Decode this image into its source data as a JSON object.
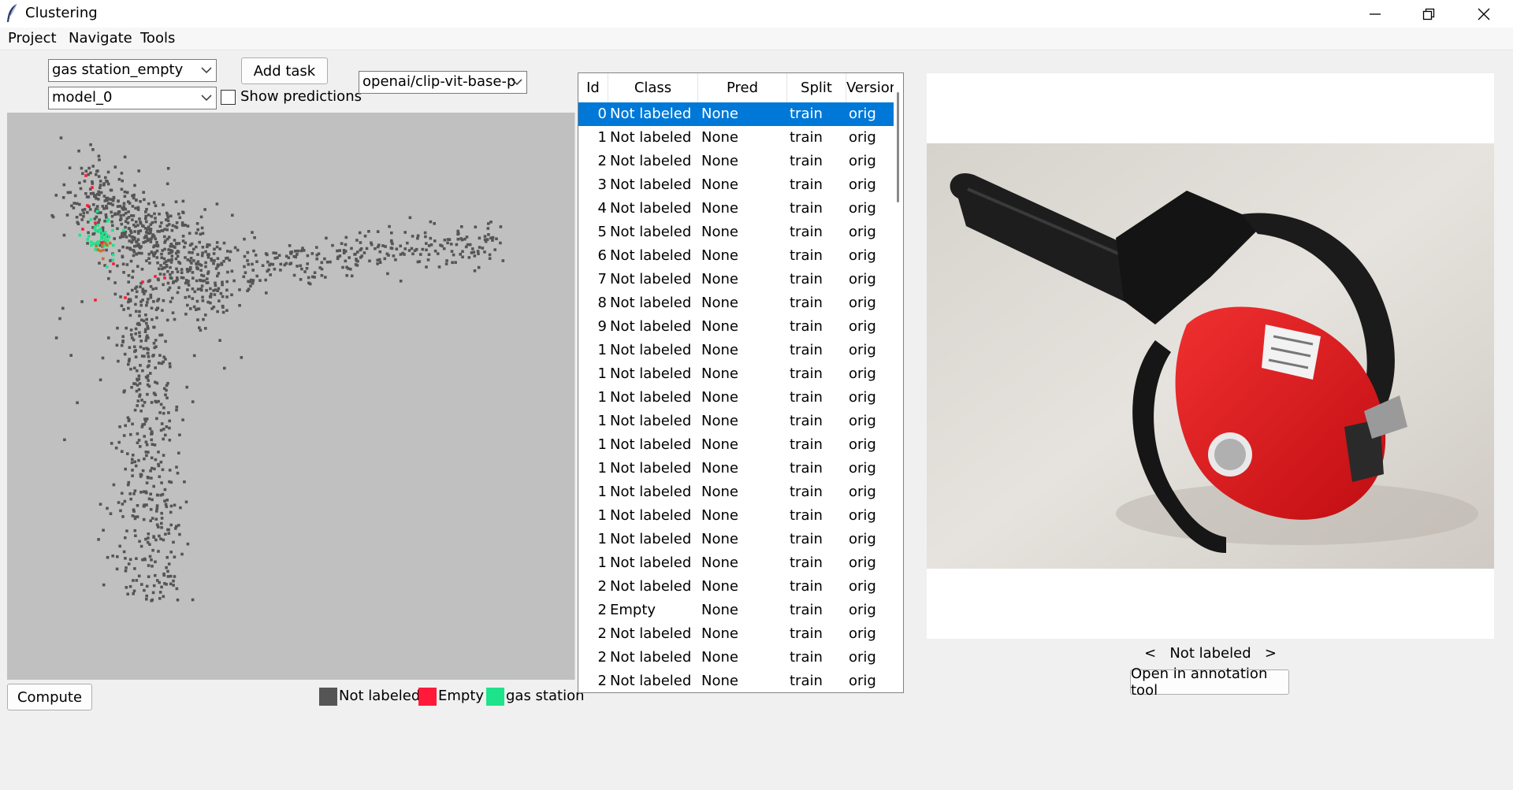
{
  "window": {
    "title": "Clustering"
  },
  "menu": [
    "Project",
    "Navigate",
    "Tools"
  ],
  "controls": {
    "task_select": "gas station_empty",
    "model_select": "model_0",
    "add_task_label": "Add task",
    "show_predictions_label": "Show predictions",
    "show_predictions_checked": false,
    "embedding_model_select": "openai/clip-vit-base-p",
    "compute_label": "Compute"
  },
  "legend": [
    {
      "label": "Not labeled",
      "color": "#555555"
    },
    {
      "label": "Empty",
      "color": "#ff1a3a"
    },
    {
      "label": "gas station",
      "color": "#1fe38a"
    }
  ],
  "table": {
    "columns": [
      "Id",
      "Class",
      "Pred",
      "Split",
      "Version"
    ],
    "selected_row": 0,
    "rows": [
      {
        "id": "0",
        "class": "Not labeled",
        "pred": "None",
        "split": "train",
        "version": "orig"
      },
      {
        "id": "1",
        "class": "Not labeled",
        "pred": "None",
        "split": "train",
        "version": "orig"
      },
      {
        "id": "2",
        "class": "Not labeled",
        "pred": "None",
        "split": "train",
        "version": "orig"
      },
      {
        "id": "3",
        "class": "Not labeled",
        "pred": "None",
        "split": "train",
        "version": "orig"
      },
      {
        "id": "4",
        "class": "Not labeled",
        "pred": "None",
        "split": "train",
        "version": "orig"
      },
      {
        "id": "5",
        "class": "Not labeled",
        "pred": "None",
        "split": "train",
        "version": "orig"
      },
      {
        "id": "6",
        "class": "Not labeled",
        "pred": "None",
        "split": "train",
        "version": "orig"
      },
      {
        "id": "7",
        "class": "Not labeled",
        "pred": "None",
        "split": "train",
        "version": "orig"
      },
      {
        "id": "8",
        "class": "Not labeled",
        "pred": "None",
        "split": "train",
        "version": "orig"
      },
      {
        "id": "9",
        "class": "Not labeled",
        "pred": "None",
        "split": "train",
        "version": "orig"
      },
      {
        "id": "1",
        "class": "Not labeled",
        "pred": "None",
        "split": "train",
        "version": "orig"
      },
      {
        "id": "1",
        "class": "Not labeled",
        "pred": "None",
        "split": "train",
        "version": "orig"
      },
      {
        "id": "1",
        "class": "Not labeled",
        "pred": "None",
        "split": "train",
        "version": "orig"
      },
      {
        "id": "1",
        "class": "Not labeled",
        "pred": "None",
        "split": "train",
        "version": "orig"
      },
      {
        "id": "1",
        "class": "Not labeled",
        "pred": "None",
        "split": "train",
        "version": "orig"
      },
      {
        "id": "1",
        "class": "Not labeled",
        "pred": "None",
        "split": "train",
        "version": "orig"
      },
      {
        "id": "1",
        "class": "Not labeled",
        "pred": "None",
        "split": "train",
        "version": "orig"
      },
      {
        "id": "1",
        "class": "Not labeled",
        "pred": "None",
        "split": "train",
        "version": "orig"
      },
      {
        "id": "1",
        "class": "Not labeled",
        "pred": "None",
        "split": "train",
        "version": "orig"
      },
      {
        "id": "1",
        "class": "Not labeled",
        "pred": "None",
        "split": "train",
        "version": "orig"
      },
      {
        "id": "2",
        "class": "Not labeled",
        "pred": "None",
        "split": "train",
        "version": "orig"
      },
      {
        "id": "2",
        "class": "Empty",
        "pred": "None",
        "split": "train",
        "version": "orig"
      },
      {
        "id": "2",
        "class": "Not labeled",
        "pred": "None",
        "split": "train",
        "version": "orig"
      },
      {
        "id": "2",
        "class": "Not labeled",
        "pred": "None",
        "split": "train",
        "version": "orig"
      },
      {
        "id": "2",
        "class": "Not labeled",
        "pred": "None",
        "split": "train",
        "version": "orig"
      }
    ]
  },
  "preview": {
    "label": "Not labeled",
    "prev_symbol": "<",
    "next_symbol": ">",
    "open_annotation_label": "Open in annotation tool",
    "subject": "red chainsaw on light floor"
  },
  "icons": {
    "app": "feather-icon",
    "minimize": "minimize-icon",
    "restore": "restore-icon",
    "close": "close-icon",
    "dropdown": "chevron-down-icon"
  }
}
